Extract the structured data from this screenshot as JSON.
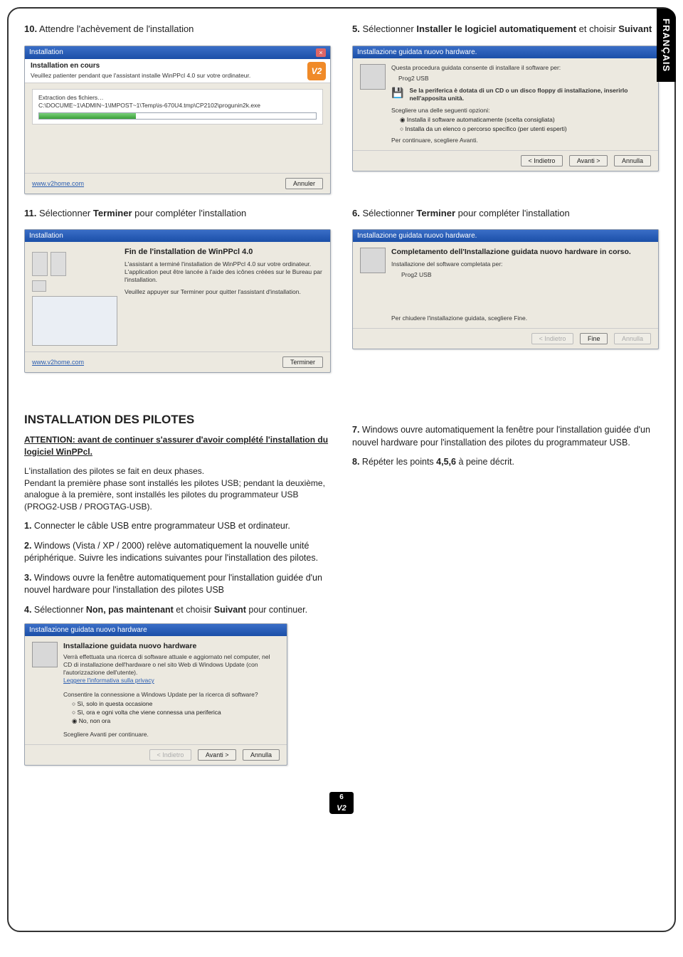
{
  "lang_tab": "FRANÇAIS",
  "page_number": "6",
  "footer_logo": "V2",
  "left": {
    "s10": {
      "n": "10.",
      "text": "Attendre l'achèvement de l'installation"
    },
    "s11": {
      "n": "11.",
      "pre": "Sélectionner ",
      "bold": "Terminer",
      "post": " pour compléter l'installation"
    },
    "dlg10": {
      "title": "Installation",
      "h": "Installation en cours",
      "sub": "Veuillez patienter pendant que l'assistant installe WinPPcl 4.0 sur votre ordinateur.",
      "extracting": "Extraction des fichiers…",
      "path": "C:\\DOCUME~1\\ADMIN~1\\IMPOST~1\\Temp\\is-670U4.tmp\\CP2102\\progunin2k.exe",
      "link": "www.v2home.com",
      "cancel": "Annuler"
    },
    "dlg11": {
      "title": "Installation",
      "h": "Fin de l'installation de WinPPcl 4.0",
      "p1": "L'assistant a terminé l'installation de WinPPcl 4.0 sur votre ordinateur. L'application peut être lancée à l'aide des icônes créées sur le Bureau par l'installation.",
      "p2": "Veuillez appuyer sur Terminer pour quitter l'assistant d'installation.",
      "link": "www.v2home.com",
      "finish": "Terminer"
    }
  },
  "right": {
    "s5": {
      "n": "5.",
      "pre": "Sélectionner ",
      "b1": "Installer le logiciel automatiquement",
      "mid": " et choisir ",
      "b2": "Suivant"
    },
    "s6": {
      "n": "6.",
      "pre": "Sélectionner ",
      "bold": "Terminer",
      "post": " pour compléter l'installation"
    },
    "dlg5": {
      "title": "Installazione guidata nuovo hardware.",
      "desc": "Questa procedura guidata consente di installare il software per:",
      "dev": "Prog2 USB",
      "cd": "Se la periferica è dotata di un CD o un disco floppy di installazione, inserirlo nell'apposita unità.",
      "choose": "Scegliere una delle seguenti opzioni:",
      "opt1": "Installa il software automaticamente (scelta consigliata)",
      "opt2": "Installa da un elenco o percorso specifico (per utenti esperti)",
      "cont": "Per continuare, scegliere Avanti.",
      "back": "< Indietro",
      "next": "Avanti >",
      "cancel": "Annulla"
    },
    "dlg6": {
      "title": "Installazione guidata nuovo hardware.",
      "h": "Completamento dell'Installazione guidata nuovo hardware in corso.",
      "done": "Installazione del software completata per:",
      "dev": "Prog2 USB",
      "close": "Per chiudere l'installazione guidata, scegliere Fine.",
      "back": "< Indietro",
      "finish": "Fine",
      "cancel": "Annulla"
    }
  },
  "pilotes": {
    "title": "INSTALLATION DES PILOTES",
    "attention": "ATTENTION: avant de continuer s'assurer d'avoir complété l'installation du logiciel WinPPcl.",
    "p": "L'installation des pilotes se fait en deux phases.\nPendant la première phase sont installés les pilotes USB;  pendant la deuxième, analogue à la première, sont installés les pilotes du programmateur USB (PROG2-USB / PROGTAG-USB).",
    "i1": {
      "n": "1.",
      "t": "Connecter le câble USB entre programmateur USB et ordinateur."
    },
    "i2": {
      "n": "2.",
      "t": "Windows (Vista / XP / 2000) relève automatiquement la nouvelle unité périphérique. Suivre les indications suivantes pour l'installation des pilotes."
    },
    "i3": {
      "n": "3.",
      "t": "Windows ouvre la fenêtre automatiquement pour l'installation guidée d'un nouvel hardware pour l'installation des pilotes USB"
    },
    "i4": {
      "n": "4.",
      "pre": "Sélectionner ",
      "b1": "Non, pas maintenant",
      "mid": " et choisir ",
      "b2": "Suivant",
      "post": " pour continuer."
    },
    "i7": {
      "n": "7.",
      "t": "Windows ouvre automatiquement la fenêtre pour l'installation guidée d'un nouvel hardware pour l'installation des pilotes du programmateur USB."
    },
    "i8": {
      "n": "8.",
      "pre": "Répéter les points ",
      "b": "4,5,6",
      "post": " à peine décrit."
    },
    "dlg4": {
      "title": "Installazione guidata nuovo hardware",
      "h": "Installazione guidata nuovo hardware",
      "p": "Verrà effettuata una ricerca di software attuale e aggiornato nel computer, nel CD di installazione dell'hardware o nel sito Web di Windows Update (con l'autorizzazione dell'utente).",
      "link": "Leggere l'informativa sulla privacy",
      "q": "Consentire la connessione a Windows Update per la ricerca di software?",
      "o1": "Sì, solo in questa occasione",
      "o2": "Sì, ora e ogni volta che viene connessa una periferica",
      "o3": "No, non ora",
      "cont": "Scegliere Avanti per continuare.",
      "back": "< Indietro",
      "next": "Avanti >",
      "cancel": "Annulla"
    }
  }
}
